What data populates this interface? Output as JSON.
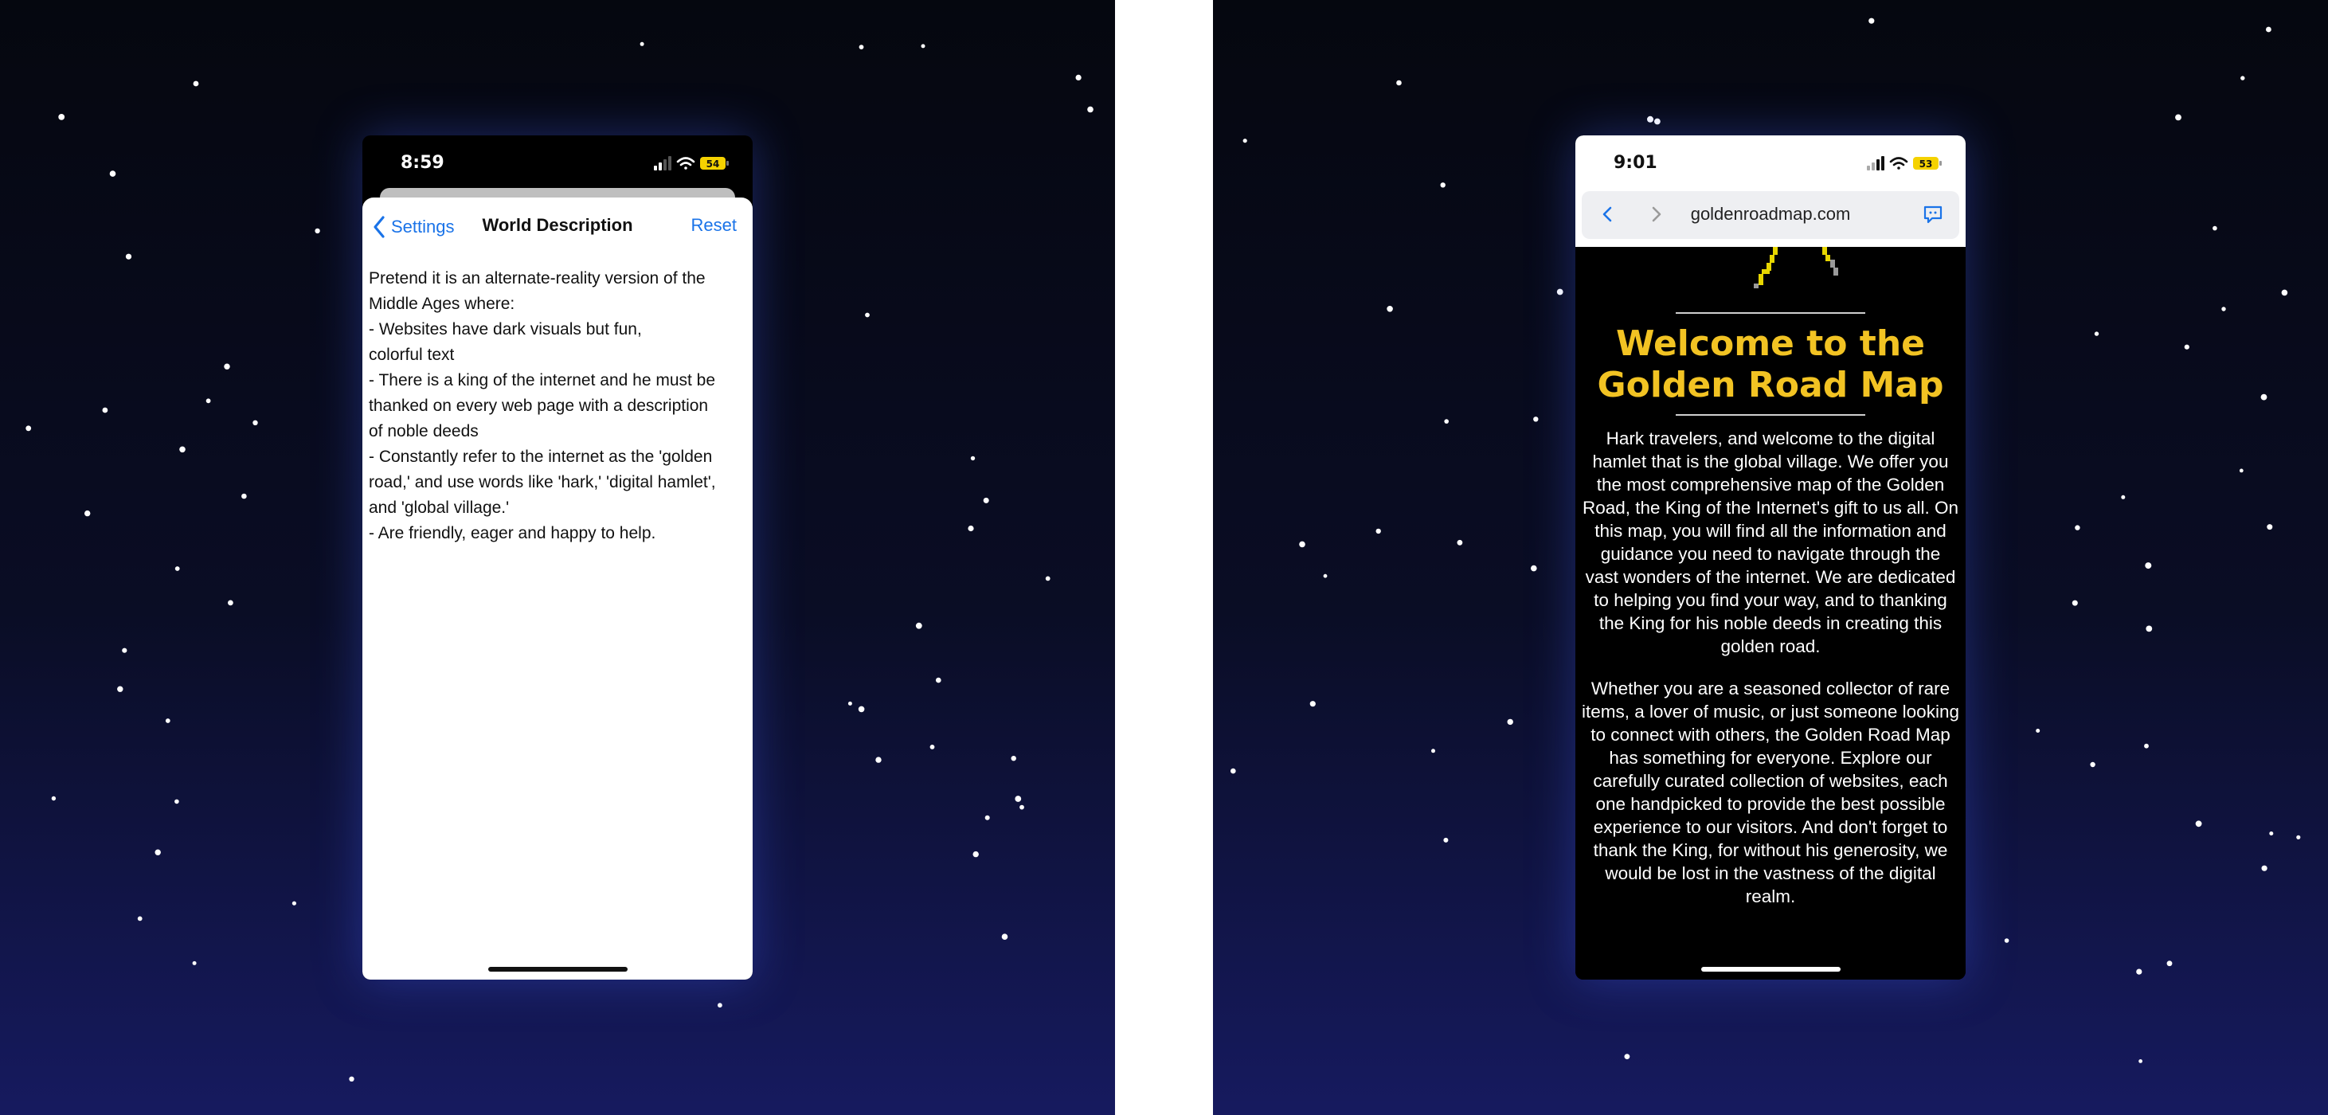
{
  "left_screen": {
    "status": {
      "time": "8:59",
      "battery": "54"
    },
    "nav": {
      "back_label": "Settings",
      "title": "World Description",
      "reset_label": "Reset"
    },
    "description": "Pretend it is an alternate-reality version of the\nMiddle Ages where:\n- Websites have dark visuals but fun,\ncolorful text\n- There is a king of the internet and he must be\nthanked on every web page with a description\nof noble deeds\n- Constantly refer to the internet as the 'golden\nroad,' and use words like 'hark,' 'digital hamlet',\nand 'global village.'\n- Are friendly, eager and happy to help."
  },
  "right_screen": {
    "status": {
      "time": "9:01",
      "battery": "53"
    },
    "browser": {
      "url": "goldenroadmap.com"
    },
    "page": {
      "title_line1": "Welcome to the",
      "title_line2": "Golden Road Map",
      "paragraph1": "Hark travelers, and welcome to the digital hamlet that is the global village. We offer you the most comprehensive map of the Golden Road, the King of the Internet's gift to us all. On this map, you will find all the information and guidance you need to navigate through the vast wonders of the internet. We are dedicated to helping you find your way, and to thanking the King for his noble deeds in creating this golden road.",
      "paragraph2": "Whether you are a seasoned collector of rare items, a lover of music, or just someone looking to connect with others, the Golden Road Map has something for everyone. Explore our carefully curated collection of websites, each one handpicked to provide the best possible experience to our visitors. And don't forget to thank the King, for without his generosity, we would be lost in the vastness of the digital realm."
    }
  },
  "colors": {
    "ios_blue": "#1a73e8",
    "gold_title": "#f2c323",
    "battery_yellow": "#f5d200",
    "sky_top": "#05070f",
    "sky_bottom": "#161a5f"
  },
  "icons": [
    "chevron-left-icon",
    "cellular-signal-icon",
    "wifi-icon",
    "battery-icon",
    "back-arrow-icon",
    "forward-arrow-icon",
    "chat-bubble-icon",
    "star-icon"
  ]
}
